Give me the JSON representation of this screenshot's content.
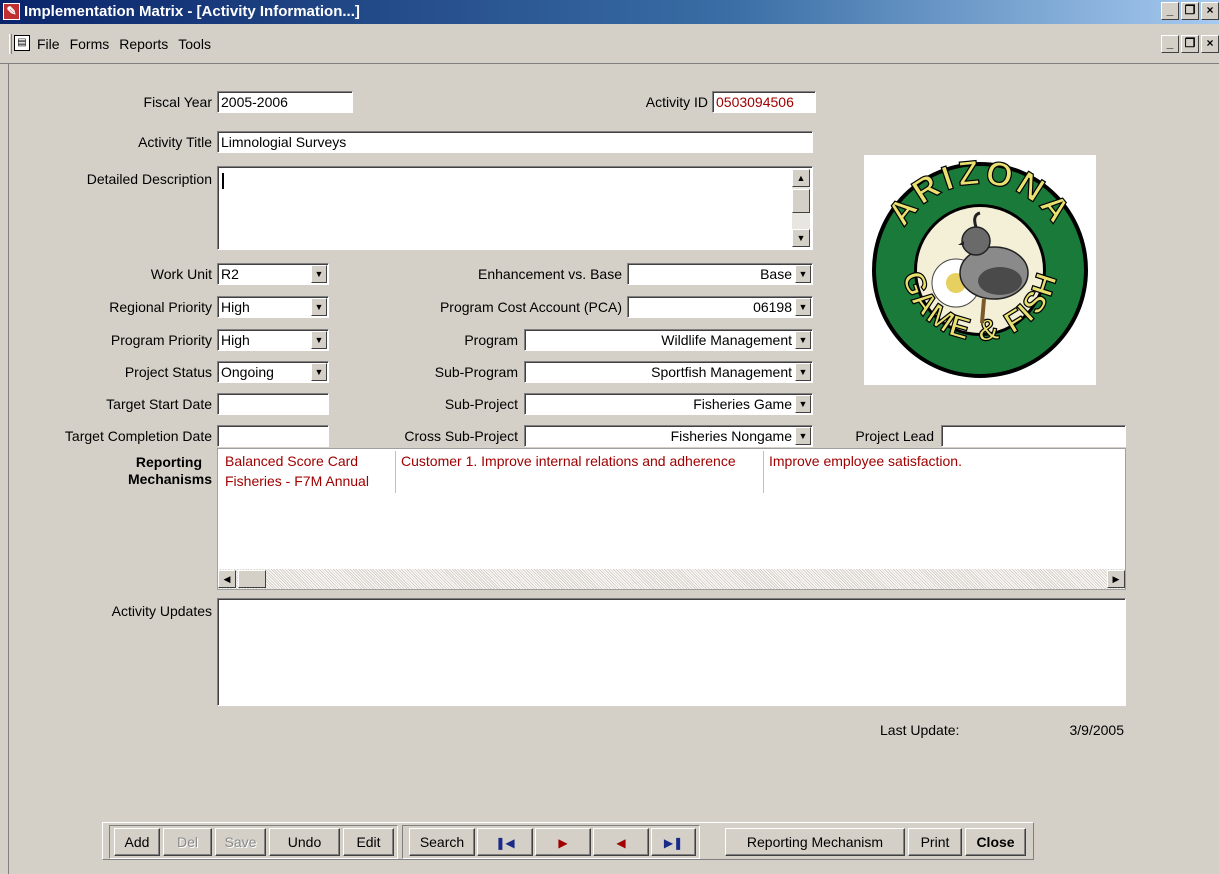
{
  "window": {
    "title": "Implementation Matrix - [Activity Information...]"
  },
  "menu": {
    "items": [
      "File",
      "Forms",
      "Reports",
      "Tools"
    ]
  },
  "fields": {
    "fiscal_year": {
      "label": "Fiscal Year",
      "value": "2005-2006"
    },
    "activity_id": {
      "label": "Activity ID",
      "value": "0503094506"
    },
    "activity_title": {
      "label": "Activity Title",
      "value": "Limnologial Surveys"
    },
    "detailed_description": {
      "label": "Detailed Description",
      "value": ""
    },
    "work_unit": {
      "label": "Work Unit",
      "value": "R2"
    },
    "regional_priority": {
      "label": "Regional Priority",
      "value": "High"
    },
    "program_priority": {
      "label": "Program Priority",
      "value": "High"
    },
    "project_status": {
      "label": "Project Status",
      "value": "Ongoing"
    },
    "target_start_date": {
      "label": "Target Start Date",
      "value": ""
    },
    "target_completion_date": {
      "label": "Target Completion Date",
      "value": ""
    },
    "enhancement_vs_base": {
      "label": "Enhancement vs. Base",
      "value": "Base"
    },
    "program_cost_account": {
      "label": "Program Cost Account (PCA)",
      "value": "06198"
    },
    "program": {
      "label": "Program",
      "value": "Wildlife Management"
    },
    "sub_program": {
      "label": "Sub-Program",
      "value": "Sportfish Management"
    },
    "sub_project": {
      "label": "Sub-Project",
      "value": "Fisheries Game"
    },
    "cross_sub_project": {
      "label": "Cross Sub-Project",
      "value": "Fisheries Nongame"
    },
    "project_lead": {
      "label": "Project Lead",
      "value": ""
    },
    "activity_updates": {
      "label": "Activity Updates",
      "value": ""
    }
  },
  "reporting": {
    "label_line1": "Reporting",
    "label_line2": "Mechanisms",
    "rows": [
      [
        "Balanced Score Card",
        "Customer 1. Improve internal relations and adherence",
        "Improve employee satisfaction."
      ],
      [
        "Fisheries - F7M Annual",
        "",
        ""
      ]
    ]
  },
  "last_update": {
    "label": "Last Update:",
    "value": "3/9/2005"
  },
  "toolbar": {
    "add": "Add",
    "del": "Del",
    "save": "Save",
    "undo": "Undo",
    "edit": "Edit",
    "search": "Search",
    "reporting_mechanism": "Reporting Mechanism",
    "print": "Print",
    "close": "Close"
  },
  "logo": {
    "top_text": "ARIZONA",
    "bottom_text": "GAME & FISH",
    "ring_color": "#1a7a3a",
    "text_color": "#e8e070"
  }
}
